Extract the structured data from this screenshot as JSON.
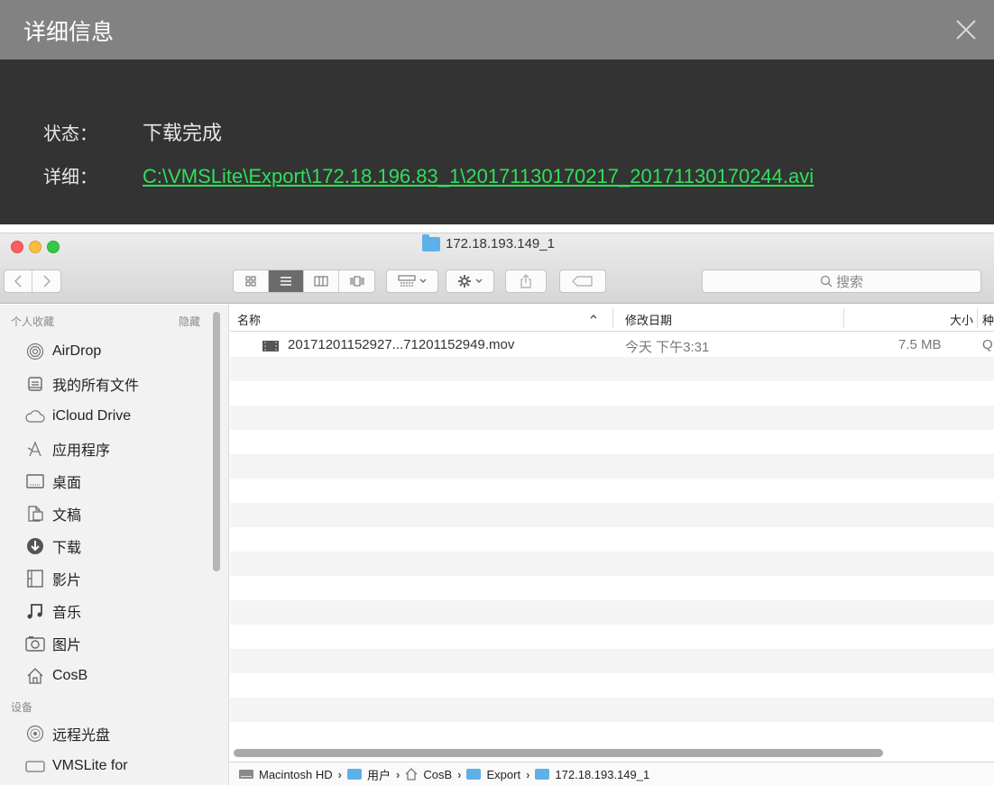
{
  "dialog": {
    "title": "详细信息",
    "status_label": "状态：",
    "status_value": "下载完成",
    "detail_label": "详细：",
    "detail_link": "C:\\VMSLite\\Export\\172.18.196.83_1\\20171130170217_20171130170244.avi"
  },
  "finder": {
    "window_title": "172.18.193.149_1",
    "search_placeholder": "搜索",
    "sidebar": {
      "favorites_header": "个人收藏",
      "hide_label": "隐藏",
      "items": [
        {
          "label": "AirDrop",
          "icon": "airdrop-icon"
        },
        {
          "label": "我的所有文件",
          "icon": "all-files-icon"
        },
        {
          "label": "iCloud Drive",
          "icon": "cloud-icon"
        },
        {
          "label": "应用程序",
          "icon": "applications-icon"
        },
        {
          "label": "桌面",
          "icon": "desktop-icon"
        },
        {
          "label": "文稿",
          "icon": "documents-icon"
        },
        {
          "label": "下载",
          "icon": "downloads-icon"
        },
        {
          "label": "影片",
          "icon": "movies-icon"
        },
        {
          "label": "音乐",
          "icon": "music-icon"
        },
        {
          "label": "图片",
          "icon": "pictures-icon"
        },
        {
          "label": "CosB",
          "icon": "home-icon"
        }
      ],
      "devices_header": "设备",
      "devices": [
        {
          "label": "远程光盘",
          "icon": "disc-icon"
        },
        {
          "label": "VMSLite for",
          "icon": "drive-icon"
        }
      ]
    },
    "columns": {
      "name": "名称",
      "modified": "修改日期",
      "size": "大小",
      "kind": "种"
    },
    "files": [
      {
        "name": "20171201152927...71201152949.mov",
        "modified": "今天 下午3:31",
        "size": "7.5 MB",
        "kind": "Q"
      }
    ],
    "path": [
      "Macintosh HD",
      "用户",
      "CosB",
      "Export",
      "172.18.193.149_1"
    ]
  }
}
